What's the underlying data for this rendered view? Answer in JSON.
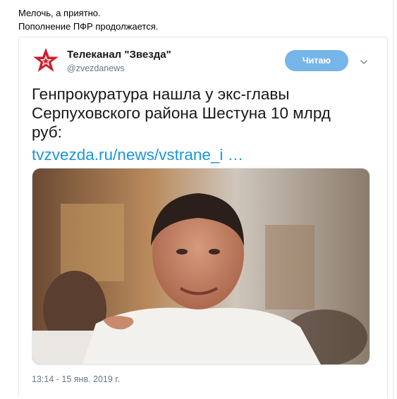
{
  "post": {
    "line1": "Мелочь, а приятно.",
    "line2": "Пополнение ПФР продолжается."
  },
  "tweet": {
    "author_name": "Телеканал \"Звезда\"",
    "author_handle": "@zvezdanews",
    "follow_label": "Читаю",
    "text_lines": [
      "Генпрокуратура нашла у экс-главы",
      "Серпуховского района Шестуна 10 млрд",
      "руб:"
    ],
    "link_text": "tvzvezda.ru/news/vstrane_i …",
    "timestamp": "13:14 - 15 янв. 2019 г."
  },
  "icons": {
    "logo": "zvezda-star-logo",
    "menu": "chevron-down-icon"
  },
  "colors": {
    "follow_button": "#76b5e9",
    "link": "#1b95e0",
    "logo_red": "#d11d2a",
    "muted": "#657786"
  }
}
